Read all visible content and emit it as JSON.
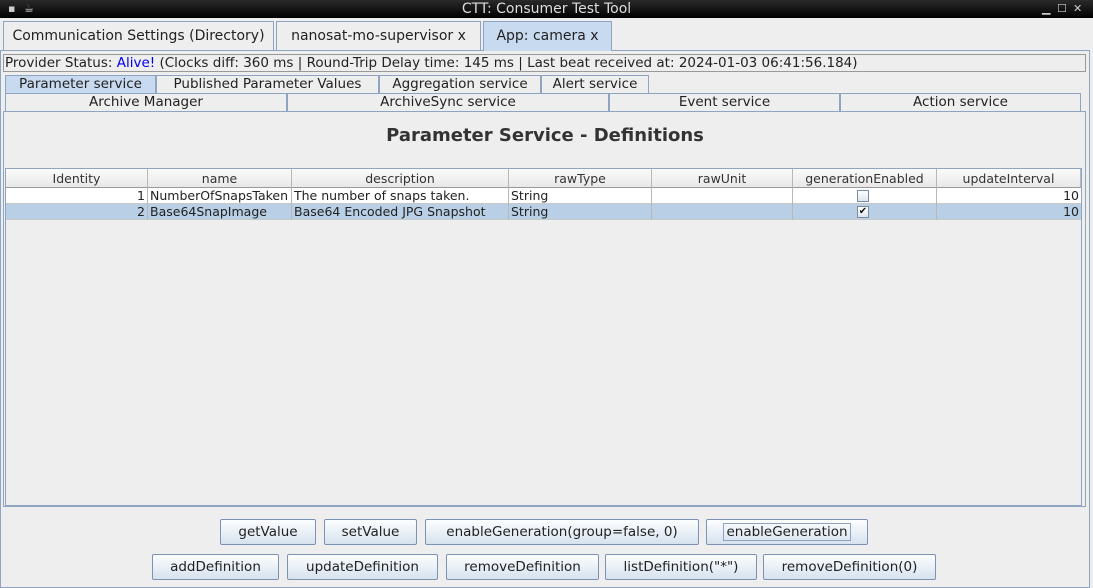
{
  "window": {
    "title": "CTT: Consumer Test Tool"
  },
  "top_tabs": [
    {
      "label": "Communication Settings (Directory)"
    },
    {
      "label": "nanosat-mo-supervisor x"
    },
    {
      "label": "App: camera x",
      "selected": true
    }
  ],
  "status": {
    "prefix": "Provider Status: ",
    "state": "Alive!",
    "details": " (Clocks diff: 360 ms | Round-Trip Delay time: 145 ms | Last beat received at: 2024-01-03 06:41:56.184)",
    "state_color": "#0000ee"
  },
  "service_tabs_row1": [
    {
      "label": "Parameter service",
      "selected": true
    },
    {
      "label": "Published Parameter Values"
    },
    {
      "label": "Aggregation service"
    },
    {
      "label": "Alert service"
    }
  ],
  "service_tabs_row2": [
    {
      "label": "Archive Manager"
    },
    {
      "label": "ArchiveSync service"
    },
    {
      "label": "Event service"
    },
    {
      "label": "Action service"
    }
  ],
  "panel": {
    "title": "Parameter Service - Definitions"
  },
  "table": {
    "columns": [
      "Identity",
      "name",
      "description",
      "rawType",
      "rawUnit",
      "generationEnabled",
      "updateInterval"
    ],
    "rows": [
      {
        "identity": "1",
        "name": "NumberOfSnapsTaken",
        "description": "The number of snaps taken.",
        "rawType": "String",
        "rawUnit": "",
        "generationEnabled": false,
        "updateInterval": "10",
        "selected": false
      },
      {
        "identity": "2",
        "name": "Base64SnapImage",
        "description": "Base64 Encoded JPG Snapshot",
        "rawType": "String",
        "rawUnit": "",
        "generationEnabled": true,
        "updateInterval": "10",
        "selected": true
      }
    ]
  },
  "buttons_row1": [
    "getValue",
    "setValue",
    "enableGeneration(group=false, 0)",
    "enableGeneration"
  ],
  "buttons_row2": [
    "addDefinition",
    "updateDefinition",
    "removeDefinition",
    "listDefinition(\"*\")",
    "removeDefinition(0)"
  ],
  "colors": {
    "selection": "#b8cfe5",
    "tab_selected": "#c8daf0"
  }
}
